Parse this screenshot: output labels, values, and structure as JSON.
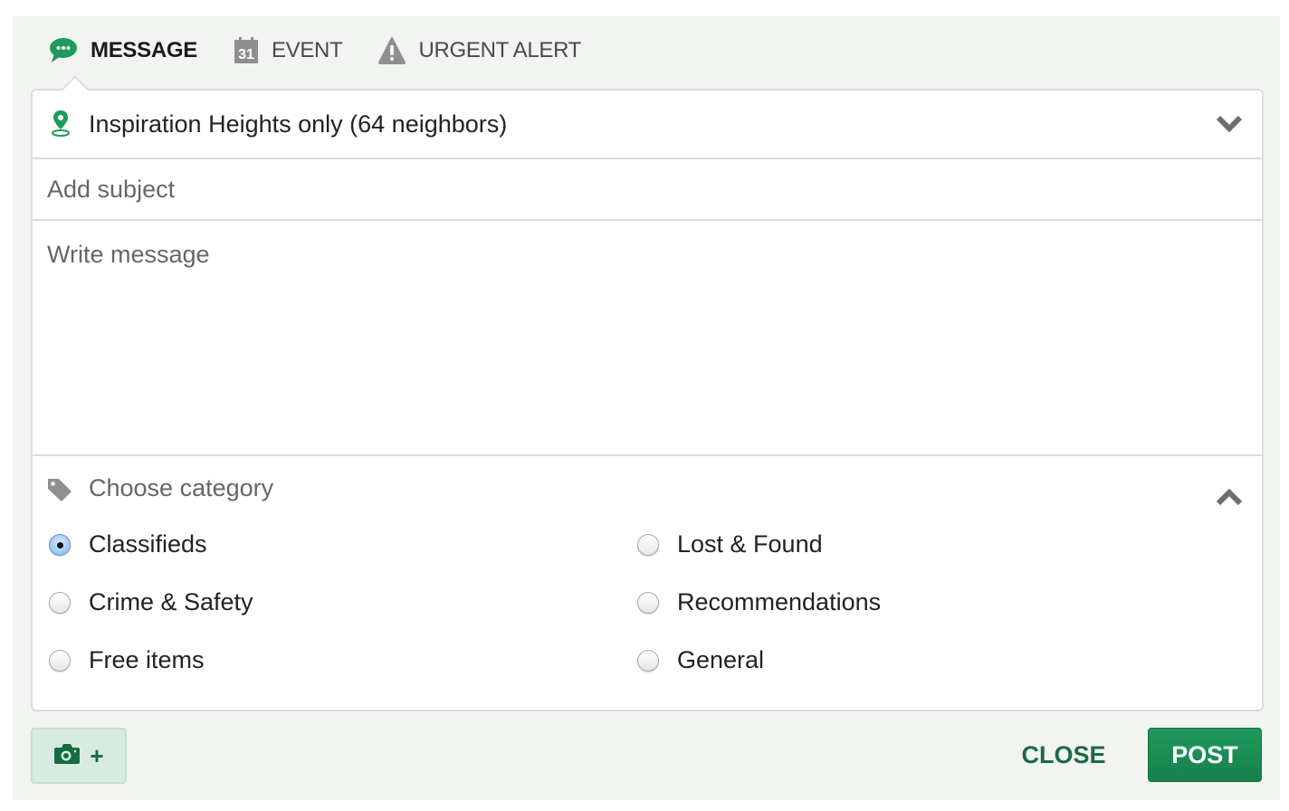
{
  "tabs": [
    {
      "label": "MESSAGE",
      "icon": "chat-bubble-icon",
      "active": true
    },
    {
      "label": "EVENT",
      "icon": "calendar-icon",
      "active": false,
      "icon_text": "31"
    },
    {
      "label": "URGENT ALERT",
      "icon": "warning-icon",
      "active": false
    }
  ],
  "audience": {
    "label": "Inspiration Heights only (64 neighbors)",
    "icon": "location-pin-icon"
  },
  "subject": {
    "placeholder": "Add subject",
    "value": ""
  },
  "message": {
    "placeholder": "Write message",
    "value": ""
  },
  "category": {
    "header": "Choose category",
    "icon": "tag-icon",
    "selected": "Classifieds",
    "options": [
      {
        "label": "Classifieds",
        "checked": true
      },
      {
        "label": "Lost & Found",
        "checked": false
      },
      {
        "label": "Crime & Safety",
        "checked": false
      },
      {
        "label": "Recommendations",
        "checked": false
      },
      {
        "label": "Free items",
        "checked": false
      },
      {
        "label": "General",
        "checked": false
      }
    ]
  },
  "footer": {
    "photo_button_plus": "+",
    "close_label": "CLOSE",
    "post_label": "POST"
  },
  "colors": {
    "brand_green": "#1b8f54",
    "dark_green": "#176b41",
    "panel_bg": "#f2f4f2"
  }
}
